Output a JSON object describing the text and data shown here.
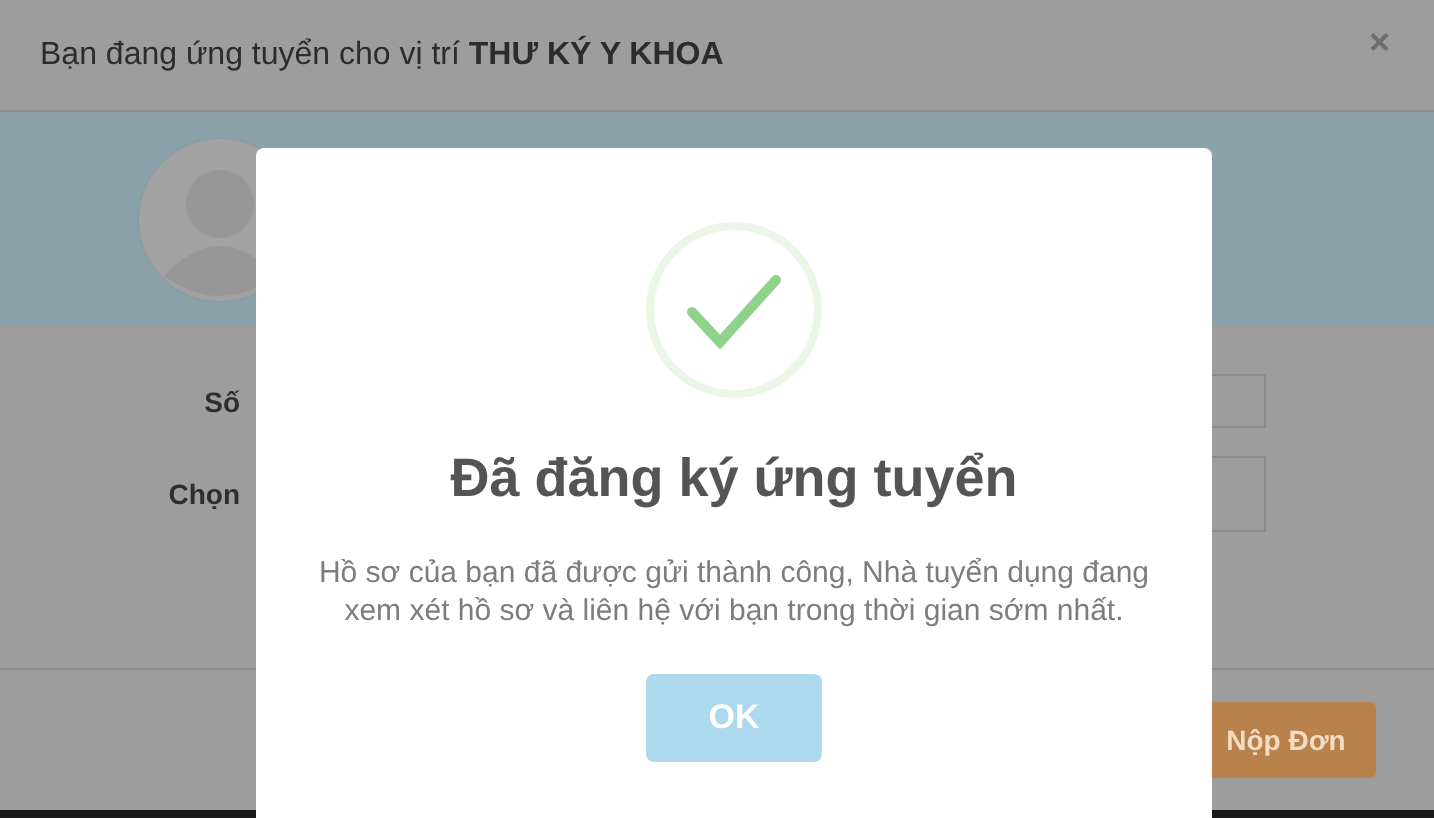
{
  "application_modal": {
    "title": "Bạn đang ứng tuyển cho vị trí **THƯ KÝ Y KHOA**",
    "close": "×",
    "fields": [
      {
        "label": "Số"
      },
      {
        "label": "Chọn"
      }
    ],
    "submit_button": "Nộp Đơn"
  },
  "success_dialog": {
    "title": "Đã đăng ký ứng tuyển",
    "message": "Hồ sơ của bạn đã được gửi thành công, Nhà tuyển dụng đang xem xét hồ sơ và liên hệ với bạn trong thời gian sớm nhất.",
    "button": "OK"
  }
}
